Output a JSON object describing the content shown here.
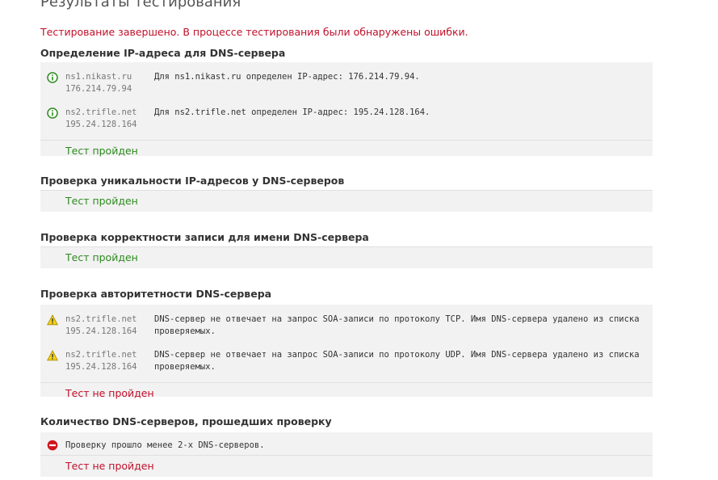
{
  "page_title": "Результаты тестирования",
  "summary": "Тестирование завершено. В процессе тестирования были обнаружены ошибки.",
  "colors": {
    "pass": "#2d8a1f",
    "fail": "#c0102a",
    "warn": "#e8c400",
    "info": "#2d8a1f",
    "error": "#c0102a"
  },
  "sections": [
    {
      "title": "Определение IP-адреса для DNS-сервера",
      "rows": [
        {
          "icon": "info-icon",
          "host": "ns1.nikast.ru",
          "ip": "176.214.79.94",
          "message": "Для ns1.nikast.ru определен IP-адрес: 176.214.79.94."
        },
        {
          "icon": "info-icon",
          "host": "ns2.trifle.net",
          "ip": "195.24.128.164",
          "message": "Для ns2.trifle.net определен IP-адрес: 195.24.128.164."
        }
      ],
      "result": "Тест пройден"
    },
    {
      "title": "Проверка уникальности IP-адресов у DNS-серверов",
      "result": "Тест пройден"
    },
    {
      "title": "Проверка корректности записи для имени DNS-сервера",
      "result": "Тест пройден"
    },
    {
      "title": "Проверка авторитетности DNS-сервера",
      "rows": [
        {
          "icon": "warning-icon",
          "host": "ns2.trifle.net",
          "ip": "195.24.128.164",
          "message": "DNS-сервер не отвечает на запрос SOA-записи по протоколу TCP. Имя DNS-сервера удалено из списка проверяемых."
        },
        {
          "icon": "warning-icon",
          "host": "ns2.trifle.net",
          "ip": "195.24.128.164",
          "message": "DNS-сервер не отвечает на запрос SOA-записи по протоколу UDP. Имя DNS-сервера удалено из списка проверяемых."
        }
      ],
      "result": "Тест не пройден"
    },
    {
      "title": "Количество DNS-серверов, прошедших проверку",
      "rows": [
        {
          "icon": "error-icon",
          "message": "Проверку прошло менее 2-х DNS-серверов."
        }
      ],
      "result": "Тест не пройден"
    }
  ]
}
